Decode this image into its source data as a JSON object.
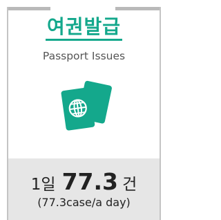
{
  "card": {
    "title": "여권발급",
    "subtitle": "Passport Issues",
    "icon": "passport-icon",
    "accent_color": "#14a88c"
  },
  "stats": {
    "prefix": "1일",
    "value": "77.3",
    "suffix": "건",
    "english": "(77.3case/a day)"
  }
}
